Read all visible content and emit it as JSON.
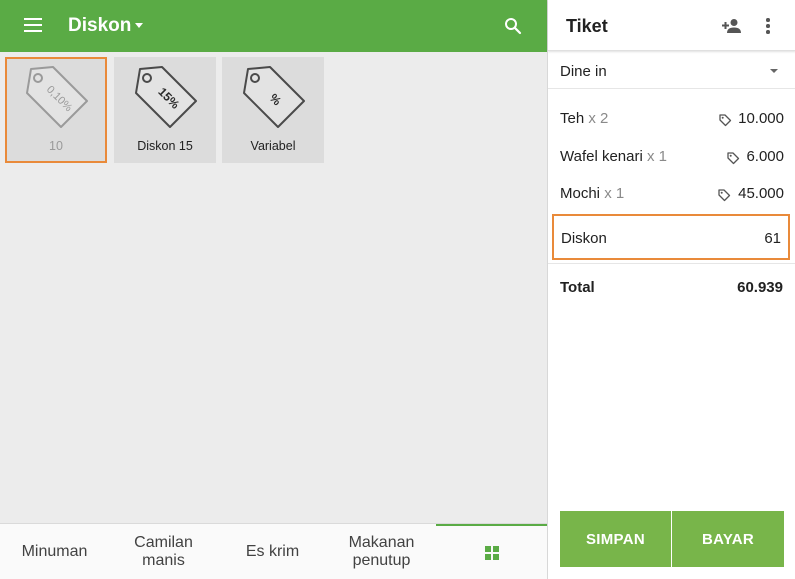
{
  "topbar": {
    "title": "Diskon"
  },
  "discounts": [
    {
      "label": "10",
      "tag_text": "0,10%",
      "selected": true
    },
    {
      "label": "Diskon 15",
      "tag_text": "15%",
      "selected": false
    },
    {
      "label": "Variabel",
      "tag_text": "%",
      "selected": false
    }
  ],
  "categories": [
    {
      "line1": "Minuman",
      "line2": ""
    },
    {
      "line1": "Camilan",
      "line2": "manis"
    },
    {
      "line1": "Es krim",
      "line2": ""
    },
    {
      "line1": "Makanan",
      "line2": "penutup"
    }
  ],
  "ticket": {
    "title": "Tiket",
    "dining_option": "Dine in",
    "items": [
      {
        "name": "Teh",
        "qty": "x 2",
        "amount": "10.000"
      },
      {
        "name": "Wafel kenari",
        "qty": "x 1",
        "amount": "6.000"
      },
      {
        "name": "Mochi",
        "qty": "x 1",
        "amount": "45.000"
      }
    ],
    "discount_label": "Diskon",
    "discount_amount": "61",
    "total_label": "Total",
    "total_value": "60.939",
    "save_label": "SIMPAN",
    "pay_label": "BAYAR"
  },
  "colors": {
    "primary": "#5aab45",
    "button": "#78b54a",
    "highlight": "#e98a3a"
  }
}
